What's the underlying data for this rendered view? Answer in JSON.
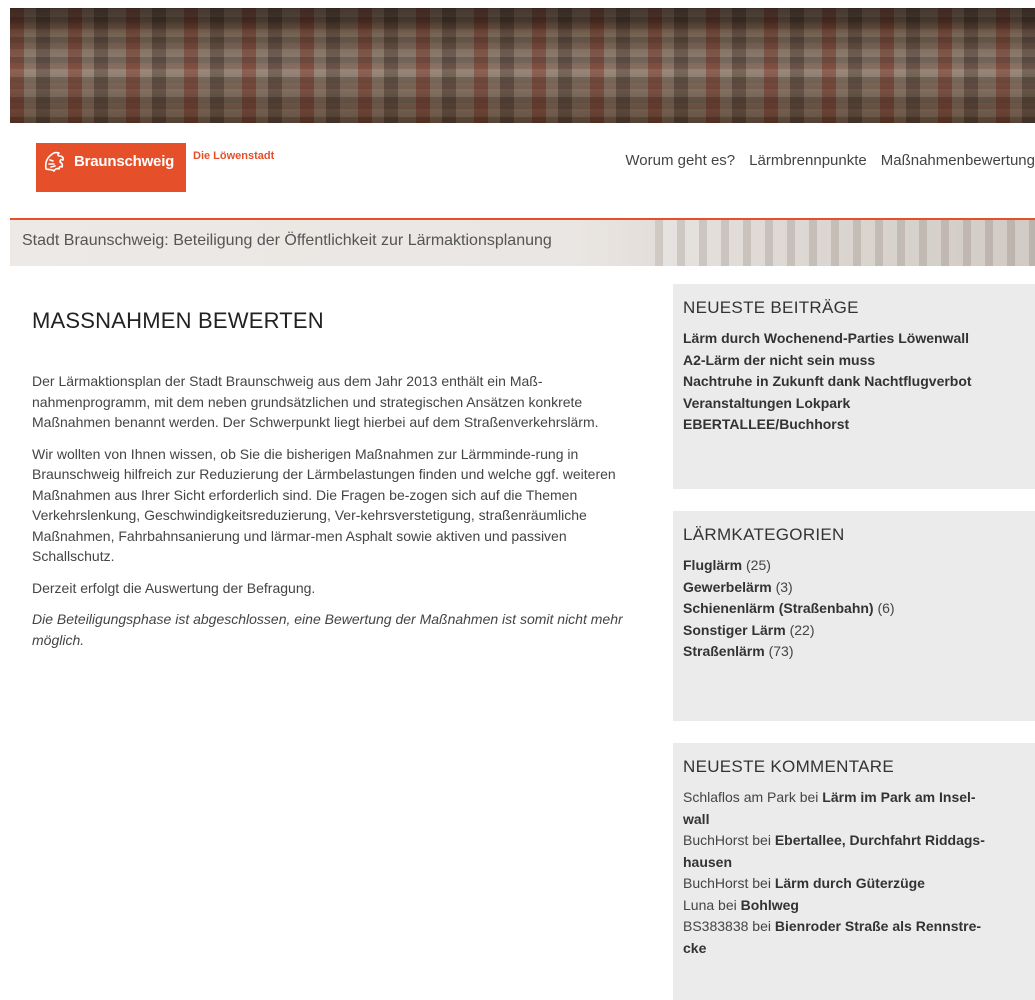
{
  "brand": {
    "name": "Braunschweig",
    "tagline": "Die Löwenstadt",
    "accent_color": "#e5502b"
  },
  "nav": {
    "items": [
      "Worum geht es?",
      "Lärmbrennpunkte",
      "Maßnahmenbewertung"
    ]
  },
  "breadcrumb": "Stadt Braunschweig: Beteiligung der Öffentlichkeit zur Lärmaktionsplanung",
  "main": {
    "title": "MASSNAHMEN BEWERTEN",
    "paragraphs": [
      "Der Lärmaktionsplan der Stadt Braunschweig aus dem Jahr 2013 enthält ein Maß-nahmenprogramm, mit dem neben grundsätzlichen und strategischen Ansätzen konkrete Maßnahmen benannt werden. Der Schwerpunkt liegt hierbei auf dem Straßenverkehrslärm.",
      "Wir wollten von Ihnen wissen, ob Sie die bisherigen Maßnahmen zur Lärmminde-rung in Braunschweig hilfreich zur Reduzierung der Lärmbelastungen finden und welche ggf. weiteren Maßnahmen aus Ihrer Sicht erforderlich sind. Die Fragen be-zogen sich auf die Themen Verkehrslenkung, Geschwindigkeitsreduzierung, Ver-kehrsverstetigung, straßenräumliche Maßnahmen, Fahrbahnsanierung und lärmar-men Asphalt sowie aktiven und passiven Schallschutz.",
      "Derzeit erfolgt die Auswertung der Befragung."
    ],
    "notice": "Die Beteiligungsphase ist abgeschlossen, eine Bewertung der Maßnahmen ist somit nicht mehr möglich."
  },
  "sidebar": {
    "recent_posts": {
      "title": "NEUESTE BEITRÄGE",
      "items": [
        "Lärm durch Wochenend-Parties Löwenwall",
        "A2-Lärm der nicht sein muss",
        "Nachtruhe in Zukunft dank Nachtflugverbot",
        "Veranstaltungen Lokpark",
        "EBERTALLEE/Buchhorst"
      ]
    },
    "categories": {
      "title": "LÄRMKATEGORIEN",
      "items": [
        {
          "name": "Fluglärm",
          "count": "(25)"
        },
        {
          "name": "Gewerbelärm",
          "count": "(3)"
        },
        {
          "name": "Schienenlärm (Straßenbahn)",
          "count": "(6)"
        },
        {
          "name": "Sonstiger Lärm",
          "count": "(22)"
        },
        {
          "name": "Straßenlärm",
          "count": "(73)"
        }
      ]
    },
    "recent_comments": {
      "title": "NEUESTE KOMMENTARE",
      "connector": "bei",
      "items": [
        {
          "author": "Schlaflos am Park",
          "post_a": "Lärm im Park am Insel-",
          "post_b": "wall"
        },
        {
          "author": "BuchHorst",
          "post_a": "Ebertallee, Durchfahrt Riddags-",
          "post_b": "hausen"
        },
        {
          "author": "BuchHorst",
          "post_a": "Lärm durch Güterzüge",
          "post_b": ""
        },
        {
          "author": "Luna",
          "post_a": "Bohlweg",
          "post_b": ""
        },
        {
          "author": "BS383838",
          "post_a": "Bienroder Straße als Rennstre-",
          "post_b": "cke"
        }
      ]
    }
  }
}
